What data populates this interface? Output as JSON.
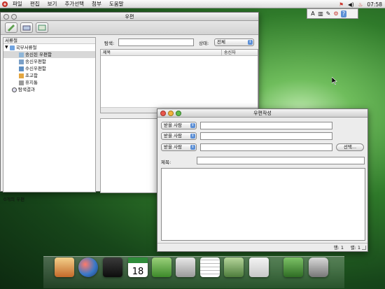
{
  "menubar": {
    "items": [
      "파일",
      "편집",
      "보기",
      "추가선택",
      "첨부",
      "도움말"
    ],
    "clock": "07:58"
  },
  "mail_window": {
    "title": "우편",
    "search_label": "탐색:",
    "status_label": "상태:",
    "status_value": "전체",
    "tree_header": "서류철",
    "tree_items": [
      {
        "label": "국부서류철",
        "icon": "folder-icon"
      },
      {
        "label": "송신된 우편함",
        "icon": "sent-mailbox-icon"
      },
      {
        "label": "송신우편함",
        "icon": "outbox-icon"
      },
      {
        "label": "수신우편함",
        "icon": "inbox-icon"
      },
      {
        "label": "초고함",
        "icon": "drafts-icon"
      },
      {
        "label": "휴지통",
        "icon": "trash-icon"
      },
      {
        "label": "탐색결과",
        "icon": "search-results-icon"
      }
    ],
    "col_subject": "제목",
    "col_sender": "송신자",
    "status_text": "0개의 우편"
  },
  "compose_window": {
    "title": "우편작성",
    "recipient_label": "받을 사람",
    "select_button": "선택...",
    "subject_label": "제목:",
    "status_row": "행: 1",
    "status_col": "렬: 1"
  },
  "colors": {
    "selection": "#d8d8d8",
    "accent_blue": "#5b8fd6",
    "close": "#e8574c",
    "minimize": "#f2b33d",
    "zoom": "#5ebc4b"
  }
}
